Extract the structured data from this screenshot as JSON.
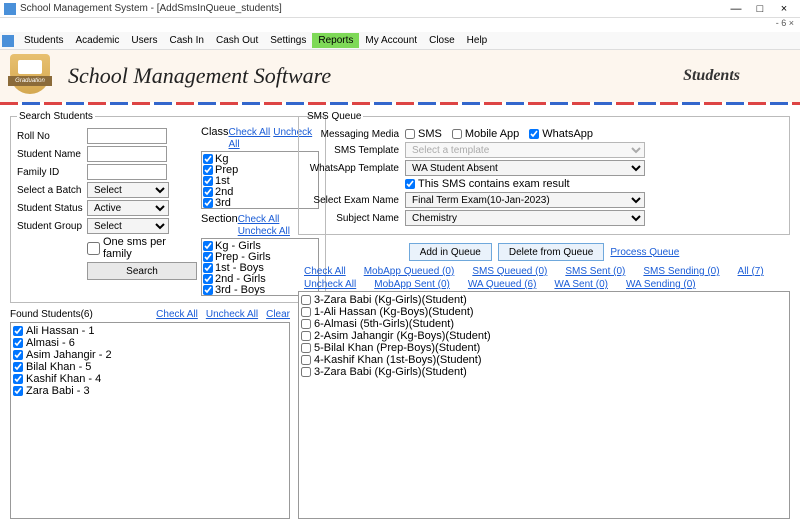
{
  "window": {
    "title": "School Management System - [AddSmsInQueue_students]",
    "subbar": "- 6 ×",
    "min": "—",
    "max": "□",
    "close": "×"
  },
  "menu": {
    "items": [
      "Students",
      "Academic",
      "Users",
      "Cash In",
      "Cash Out",
      "Settings",
      "Reports",
      "My Account",
      "Close",
      "Help"
    ],
    "highlight": "Reports"
  },
  "banner": {
    "title": "School Management Software",
    "page": "Students",
    "ribbon": "Graduation"
  },
  "search": {
    "legend": "Search Students",
    "roll_label": "Roll No",
    "roll": "",
    "name_label": "Student Name",
    "name": "",
    "family_label": "Family ID",
    "family": "",
    "batch_label": "Select a Batch",
    "batch": "Select",
    "status_label": "Student Status",
    "status": "Active",
    "group_label": "Student Group",
    "group": "Select",
    "onesms_label": "One sms per family",
    "search_btn": "Search",
    "class_label": "Class",
    "check_all": "Check All",
    "uncheck_all": "Uncheck All",
    "classes": [
      "Kg",
      "Prep",
      "1st",
      "2nd",
      "3rd"
    ],
    "section_label": "Section",
    "sections": [
      "Kg - Girls",
      "Prep - Girls",
      "1st - Boys",
      "2nd - Girls",
      "3rd - Boys"
    ]
  },
  "found": {
    "header": "Found Students(6)",
    "check_all": "Check All",
    "uncheck_all": "Uncheck All",
    "clear": "Clear",
    "items": [
      "Ali Hassan - 1",
      "Almasi - 6",
      "Asim Jahangir - 2",
      "Bilal Khan - 5",
      "Kashif Khan - 4",
      "Zara Babi - 3"
    ]
  },
  "sms": {
    "legend": "SMS Queue",
    "media_label": "Messaging Media",
    "sms_cb": "SMS",
    "mobile_cb": "Mobile App",
    "wa_cb": "WhatsApp",
    "tmpl_label": "SMS Template",
    "tmpl_ph": "Select a template",
    "wa_tmpl_label": "WhatsApp Template",
    "wa_tmpl": "WA Student Absent",
    "exam_cb": "This SMS contains exam result",
    "exam_label": "Select Exam Name",
    "exam": "Final Term Exam(10-Jan-2023)",
    "subj_label": "Subject Name",
    "subj": "Chemistry",
    "add_btn": "Add in Queue",
    "del_btn": "Delete from Queue",
    "proc_link": "Process Queue",
    "row1": {
      "check": "Check All",
      "mq": "MobApp Queued (0)",
      "sq": "SMS Queued (0)",
      "ss": "SMS Sent (0)",
      "ssend": "SMS Sending (0)",
      "all": "All (7)"
    },
    "row2": {
      "uncheck": "Uncheck All",
      "ms": "MobApp Sent (0)",
      "wq": "WA Queued (6)",
      "ws": "WA Sent (0)",
      "wsend": "WA Sending (0)"
    },
    "queue": [
      "3-Zara Babi (Kg-Girls)(Student)",
      "1-Ali Hassan (Kg-Boys)(Student)",
      "6-Almasi (5th-Girls)(Student)",
      "2-Asim Jahangir (Kg-Boys)(Student)",
      "5-Bilal Khan (Prep-Boys)(Student)",
      "4-Kashif Khan (1st-Boys)(Student)",
      "3-Zara Babi (Kg-Girls)(Student)"
    ]
  }
}
